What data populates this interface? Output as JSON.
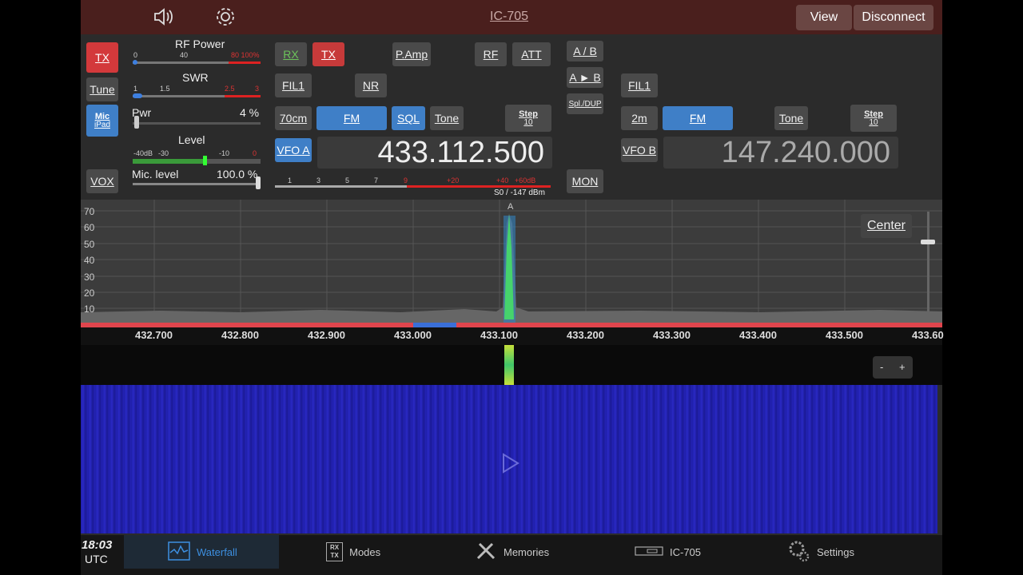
{
  "header": {
    "title": "IC-705",
    "view_label": "View",
    "disconnect_label": "Disconnect",
    "speaker_icon": "speaker-icon",
    "settings_icon": "gear-icon"
  },
  "left_panel": {
    "tx_label": "TX",
    "tune_label": "Tune",
    "mic_label": "Mic",
    "mic_source": "iPad",
    "vox_label": "VOX",
    "rf_power": {
      "title": "RF Power",
      "ticks": [
        "0",
        "40",
        "80 100%"
      ]
    },
    "swr": {
      "title": "SWR",
      "ticks": [
        "1",
        "1.5",
        "2.5",
        "3"
      ]
    },
    "pwr": {
      "label": "Pwr",
      "value": "4 %"
    },
    "level": {
      "title": "Level",
      "ticks": [
        "-40dB",
        "-30",
        "-10",
        "0"
      ]
    },
    "mic_level": {
      "label": "Mic. level",
      "value": "100.0 %"
    }
  },
  "vfo_a": {
    "rx_label": "RX",
    "tx_label": "TX",
    "pamp_label": "P.Amp",
    "rf_label": "RF",
    "att_label": "ATT",
    "fil_label": "FIL1",
    "nr_label": "NR",
    "band_label": "70cm",
    "mode_label": "FM",
    "sql_label": "SQL",
    "tone_label": "Tone",
    "step_label": "Step",
    "step_value": "10",
    "vfo_label": "VFO A",
    "frequency": "433.112.500",
    "s_meter_ticks": [
      "1",
      "3",
      "5",
      "7",
      "9",
      "+20",
      "+40",
      "+60dB"
    ],
    "s_meter_reading": "S0 / -147 dBm"
  },
  "middle_buttons": {
    "ab_label": "A / B",
    "a_to_b_label": "A ► B",
    "spl_dup_label": "Spl./DUP",
    "mon_label": "MON"
  },
  "vfo_b": {
    "fil_label": "FIL1",
    "band_label": "2m",
    "mode_label": "FM",
    "tone_label": "Tone",
    "step_label": "Step",
    "step_value": "10",
    "vfo_label": "VFO B",
    "frequency": "147.240.000"
  },
  "spectrum": {
    "y_ticks": [
      "70",
      "60",
      "50",
      "40",
      "30",
      "20",
      "10"
    ],
    "marker_label": "A",
    "center_label": "Center",
    "freq_ticks": [
      "432.700",
      "432.800",
      "432.900",
      "433.000",
      "433.100",
      "433.200",
      "433.300",
      "433.400",
      "433.500",
      "433.60"
    ],
    "zoom_minus": "-",
    "zoom_plus": "+"
  },
  "clock": {
    "time": "18:03",
    "zone": "UTC"
  },
  "tabs": [
    {
      "label": "Waterfall",
      "icon": "waterfall-icon",
      "active": true
    },
    {
      "label": "Modes",
      "icon": "rx-tx-icon",
      "active": false
    },
    {
      "label": "Memories",
      "icon": "tools-icon",
      "active": false
    },
    {
      "label": "IC-705",
      "icon": "radio-icon",
      "active": false
    },
    {
      "label": "Settings",
      "icon": "gears-icon",
      "active": false
    }
  ],
  "colors": {
    "header_bg": "#4a1f1d",
    "active_tab": "#3d8fe0",
    "tx_red": "#d3393b",
    "button_blue": "#3f7fc7",
    "waterfall_blue": "#2423b8"
  }
}
